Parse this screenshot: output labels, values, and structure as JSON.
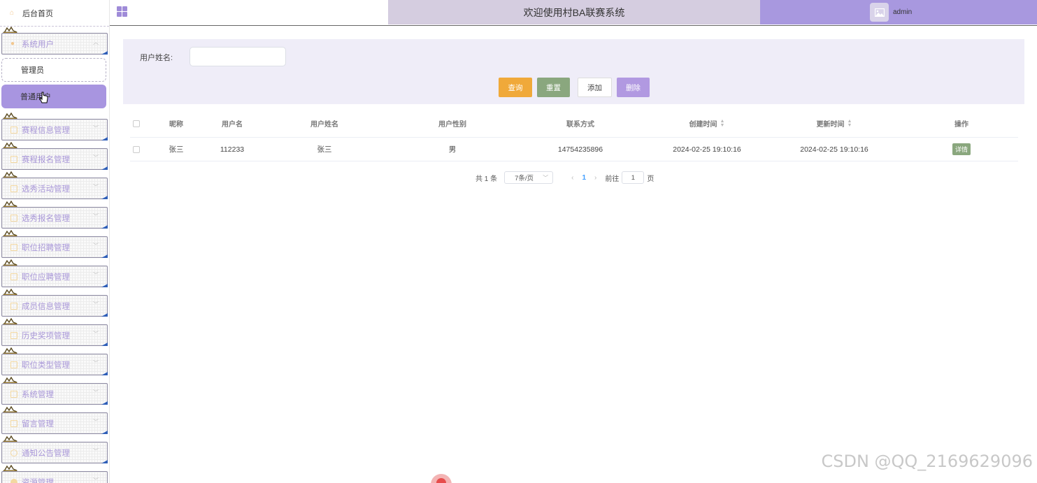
{
  "sidebar": {
    "home_label": "后台首页",
    "groups": [
      {
        "label": "系统用户",
        "icon": "user-icon",
        "children": [
          {
            "label": "管理员",
            "active": false
          },
          {
            "label": "普通用户",
            "active": true
          }
        ]
      },
      {
        "label": "赛程信息管理",
        "icon": "document-icon"
      },
      {
        "label": "赛程报名管理",
        "icon": "document-icon"
      },
      {
        "label": "选秀活动管理",
        "icon": "document-icon"
      },
      {
        "label": "选秀报名管理",
        "icon": "document-icon"
      },
      {
        "label": "职位招聘管理",
        "icon": "document-icon"
      },
      {
        "label": "职位应聘管理",
        "icon": "document-icon"
      },
      {
        "label": "成员信息管理",
        "icon": "document-icon"
      },
      {
        "label": "历史奖项管理",
        "icon": "document-icon"
      },
      {
        "label": "职位类型管理",
        "icon": "document-icon"
      },
      {
        "label": "系统管理",
        "icon": "settings-icon"
      },
      {
        "label": "留言管理",
        "icon": "message-icon"
      },
      {
        "label": "通知公告管理",
        "icon": "notice-icon"
      },
      {
        "label": "资源管理",
        "icon": "resource-icon"
      }
    ]
  },
  "header": {
    "title": "欢迎使用村BA联赛系统",
    "username": "admin"
  },
  "search": {
    "name_label": "用户姓名:",
    "name_value": "",
    "buttons": {
      "query": "查询",
      "reset": "重置",
      "add": "添加",
      "delete": "删除"
    }
  },
  "table": {
    "columns": [
      "昵称",
      "用户名",
      "用户姓名",
      "用户性别",
      "联系方式",
      "创建时间",
      "更新时间",
      "操作"
    ],
    "rows": [
      {
        "nickname": "张三",
        "username": "112233",
        "realname": "张三",
        "gender": "男",
        "phone": "14754235896",
        "created": "2024-02-25 19:10:16",
        "updated": "2024-02-25 19:10:16",
        "action": "详情"
      }
    ]
  },
  "pagination": {
    "total_text": "共 1 条",
    "page_size": "7条/页",
    "current_page": "1",
    "goto_label": "前往",
    "goto_value": "1",
    "page_unit": "页"
  },
  "watermark": "CSDN @QQ_2169629096",
  "colors": {
    "accent": "#a895e0",
    "header_title_bg": "#d5cde0",
    "query": "#f0a93a",
    "reset": "#8aa77e"
  }
}
